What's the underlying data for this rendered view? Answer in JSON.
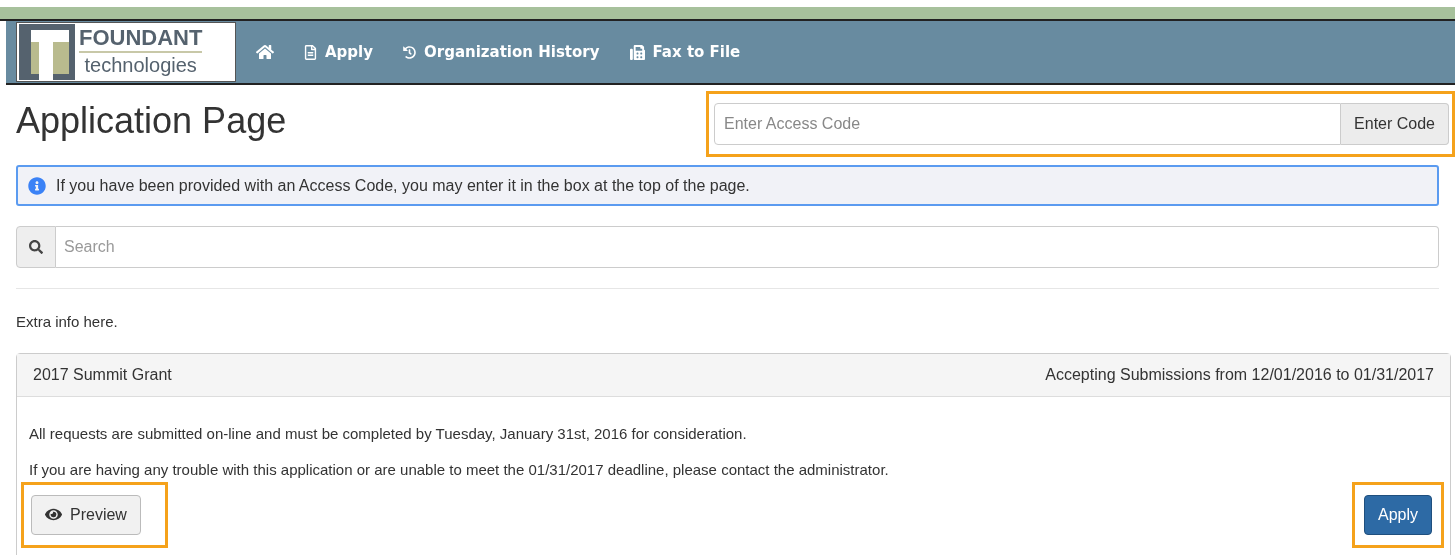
{
  "logo": {
    "name": "FOUNDANT",
    "tagline": "technologies"
  },
  "nav": [
    {
      "kind": "home"
    },
    {
      "kind": "apply",
      "label": "Apply"
    },
    {
      "kind": "history",
      "label": "Organization History"
    },
    {
      "kind": "fax",
      "label": "Fax to File"
    }
  ],
  "page_title": "Application Page",
  "access_code": {
    "placeholder": "Enter Access Code",
    "button": "Enter Code",
    "highlighted": true
  },
  "info": "If you have been provided with an Access Code, you may enter it in the box at the top of the page.",
  "search": {
    "placeholder": "Search"
  },
  "extra_info": "Extra info here.",
  "grant": {
    "title": "2017 Summit Grant",
    "dates": "Accepting Submissions from 12/01/2016 to 01/31/2017",
    "paragraphs": [
      "All requests are submitted on-line and must be completed by Tuesday, January 31st, 2016 for consideration.",
      "If you are having any trouble with this application or are unable to meet the 01/31/2017 deadline, please contact the administrator."
    ],
    "preview": {
      "label": "Preview",
      "highlighted": true
    },
    "apply": {
      "label": "Apply",
      "highlighted": true
    }
  }
}
